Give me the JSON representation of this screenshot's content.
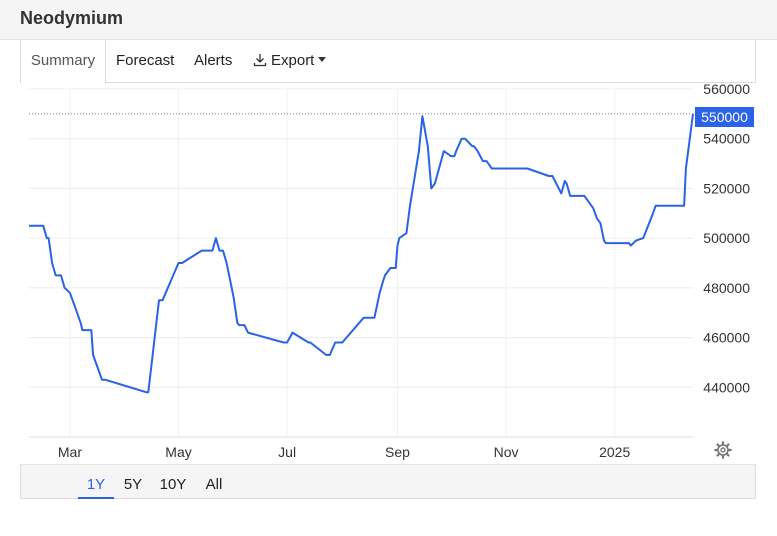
{
  "page": {
    "title": "Neodymium"
  },
  "tabs": [
    {
      "label": "Summary",
      "active": true
    },
    {
      "label": "Forecast"
    },
    {
      "label": "Alerts"
    },
    {
      "label": "Export",
      "icon": "download-icon"
    }
  ],
  "current_price": "550000",
  "ranges": [
    {
      "label": "1Y",
      "active": true
    },
    {
      "label": "5Y"
    },
    {
      "label": "10Y"
    },
    {
      "label": "All"
    }
  ],
  "colors": {
    "line": "#2a62e8",
    "badge": "#2a62e8",
    "grid": "#ececec"
  },
  "chart_data": {
    "type": "line",
    "title": "",
    "xlabel": "",
    "ylabel": "",
    "x_ticks": [
      "Mar",
      "May",
      "Jul",
      "Sep",
      "Nov",
      "2025"
    ],
    "y_ticks": [
      440000,
      460000,
      480000,
      500000,
      520000,
      540000,
      560000
    ],
    "ylim": [
      420000,
      560000
    ],
    "xlim": [
      "2024-02-07",
      "2025-02-14"
    ],
    "grid": true,
    "last_value_reference": 550000,
    "series": [
      {
        "x": [
          "2024-02-07",
          "2024-02-15",
          "2024-02-17",
          "2024-02-18",
          "2024-02-20",
          "2024-02-22",
          "2024-02-25",
          "2024-02-27",
          "2024-03-01",
          "2024-03-04",
          "2024-03-07",
          "2024-03-08",
          "2024-03-13",
          "2024-03-14",
          "2024-03-19",
          "2024-03-21",
          "2024-04-13",
          "2024-04-14",
          "2024-04-20",
          "2024-04-22",
          "2024-05-01",
          "2024-05-03",
          "2024-05-14",
          "2024-05-16",
          "2024-05-18",
          "2024-05-20",
          "2024-05-22",
          "2024-05-24",
          "2024-05-26",
          "2024-05-28",
          "2024-06-01",
          "2024-06-03",
          "2024-06-04",
          "2024-06-07",
          "2024-06-09",
          "2024-06-29",
          "2024-07-01",
          "2024-07-04",
          "2024-07-13",
          "2024-07-14",
          "2024-07-23",
          "2024-07-25",
          "2024-07-28",
          "2024-08-01",
          "2024-08-13",
          "2024-08-14",
          "2024-08-16",
          "2024-08-19",
          "2024-08-22",
          "2024-08-24",
          "2024-08-25",
          "2024-08-28",
          "2024-08-31",
          "2024-09-01",
          "2024-09-02",
          "2024-09-06",
          "2024-09-08",
          "2024-09-13",
          "2024-09-15",
          "2024-09-18",
          "2024-09-20",
          "2024-09-22",
          "2024-09-27",
          "2024-10-01",
          "2024-10-03",
          "2024-10-04",
          "2024-10-07",
          "2024-10-09",
          "2024-10-13",
          "2024-10-14",
          "2024-10-16",
          "2024-10-19",
          "2024-10-21",
          "2024-10-24",
          "2024-10-25",
          "2024-10-28",
          "2024-11-06",
          "2024-11-13",
          "2024-11-25",
          "2024-11-27",
          "2024-12-02",
          "2024-12-04",
          "2024-12-05",
          "2024-12-07",
          "2024-12-08",
          "2024-12-13",
          "2024-12-15",
          "2024-12-19",
          "2024-12-20",
          "2024-12-22",
          "2024-12-24",
          "2024-12-26",
          "2024-12-27",
          "2025-01-03",
          "2025-01-06",
          "2025-01-09",
          "2025-01-10",
          "2025-01-13",
          "2025-01-17",
          "2025-01-22",
          "2025-01-24",
          "2025-01-25",
          "2025-02-04",
          "2025-02-09",
          "2025-02-10",
          "2025-02-14"
        ],
        "y": [
          505000,
          505000,
          500000,
          500000,
          490000,
          485000,
          485000,
          480000,
          478000,
          472000,
          466000,
          463000,
          463000,
          453000,
          443000,
          443000,
          438000,
          438000,
          475000,
          475000,
          490000,
          490000,
          495000,
          495000,
          495000,
          495000,
          500000,
          495000,
          495000,
          490000,
          476000,
          466000,
          465000,
          465000,
          462000,
          458000,
          458000,
          462000,
          458000,
          458000,
          453000,
          453000,
          458000,
          458000,
          468000,
          468000,
          468000,
          468000,
          478000,
          483000,
          485000,
          488000,
          488000,
          497000,
          500000,
          502000,
          513000,
          535000,
          549000,
          537000,
          520000,
          522000,
          535000,
          533000,
          533000,
          535000,
          540000,
          540000,
          537000,
          537000,
          535000,
          531000,
          531000,
          528000,
          528000,
          528000,
          528000,
          528000,
          525000,
          525000,
          518000,
          523000,
          522000,
          517000,
          517000,
          517000,
          517000,
          513000,
          512000,
          508000,
          506000,
          499000,
          498000,
          498000,
          498000,
          498000,
          497000,
          499000,
          500000,
          509000,
          513000,
          513000,
          513000,
          513000,
          528000,
          550000
        ]
      }
    ]
  }
}
